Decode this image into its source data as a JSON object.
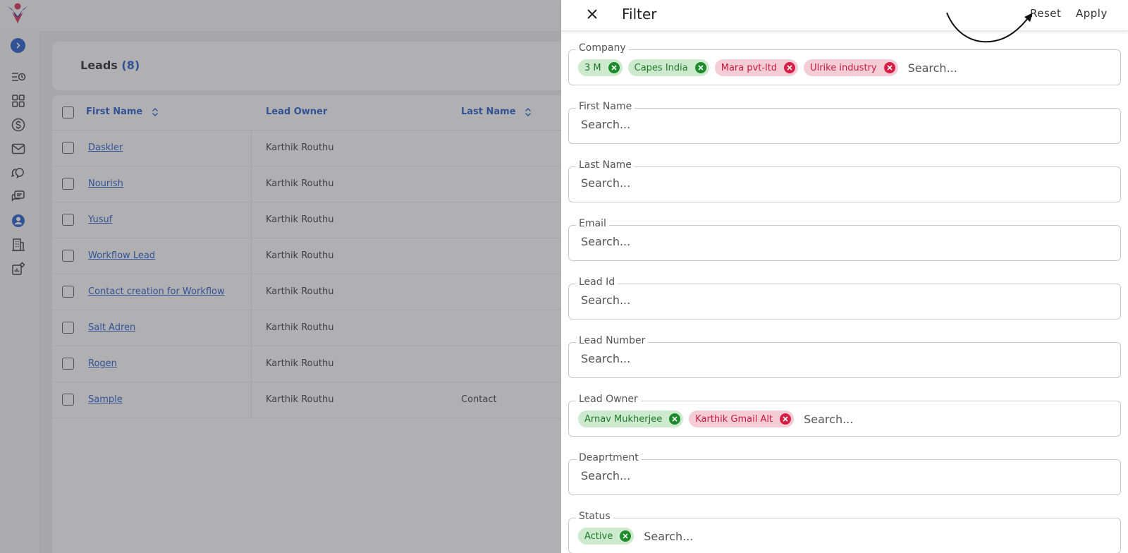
{
  "page": {
    "title": "Leads",
    "count": "(8)"
  },
  "table": {
    "columns": [
      "First Name",
      "Lead Owner",
      "Last Name"
    ],
    "rows": [
      {
        "first_name": "Daskler",
        "lead_owner": "Karthik Routhu",
        "last_name": ""
      },
      {
        "first_name": "Nourish",
        "lead_owner": "Karthik Routhu",
        "last_name": ""
      },
      {
        "first_name": "Yusuf",
        "lead_owner": "Karthik Routhu",
        "last_name": ""
      },
      {
        "first_name": "Workflow Lead",
        "lead_owner": "Karthik Routhu",
        "last_name": ""
      },
      {
        "first_name": "Contact creation for Workflow",
        "lead_owner": "Karthik Routhu",
        "last_name": ""
      },
      {
        "first_name": "Salt Adren",
        "lead_owner": "Karthik Routhu",
        "last_name": ""
      },
      {
        "first_name": "Rogen",
        "lead_owner": "Karthik Routhu",
        "last_name": ""
      },
      {
        "first_name": "Sample",
        "lead_owner": "Karthik Routhu",
        "last_name": "Contact"
      }
    ]
  },
  "sidebar": {
    "icons": [
      "list-clock-icon",
      "grid-icon",
      "dollar-icon",
      "mail-icon",
      "chat-bubbles-icon",
      "chat-icon",
      "user-circle-icon",
      "building-icon",
      "chart-gear-icon"
    ]
  },
  "filter": {
    "title": "Filter",
    "reset_label": "Reset",
    "apply_label": "Apply",
    "search_placeholder": "Search...",
    "fields": {
      "company": {
        "label": "Company",
        "chips": [
          {
            "text": "3 M",
            "state": "ok"
          },
          {
            "text": "Capes India",
            "state": "ok"
          },
          {
            "text": "Mara pvt-ltd",
            "state": "bad"
          },
          {
            "text": "Ulrike industry",
            "state": "bad"
          }
        ]
      },
      "first_name": {
        "label": "First Name"
      },
      "last_name": {
        "label": "Last Name"
      },
      "email": {
        "label": "Email"
      },
      "lead_id": {
        "label": "Lead Id"
      },
      "lead_number": {
        "label": "Lead Number"
      },
      "lead_owner": {
        "label": "Lead Owner",
        "chips": [
          {
            "text": "Arnav Mukherjee",
            "state": "ok"
          },
          {
            "text": "Karthik Gmail Alt",
            "state": "bad"
          }
        ]
      },
      "department": {
        "label": "Deaprtment"
      },
      "status": {
        "label": "Status",
        "chips": [
          {
            "text": "Active",
            "state": "ok"
          }
        ]
      }
    }
  },
  "colors": {
    "accent": "#1a55c8",
    "chip_ok_bg": "#cdeacf",
    "chip_ok_fg": "#1f7a2a",
    "chip_bad_bg": "#f5cdd6",
    "chip_bad_fg": "#c51a3e"
  }
}
